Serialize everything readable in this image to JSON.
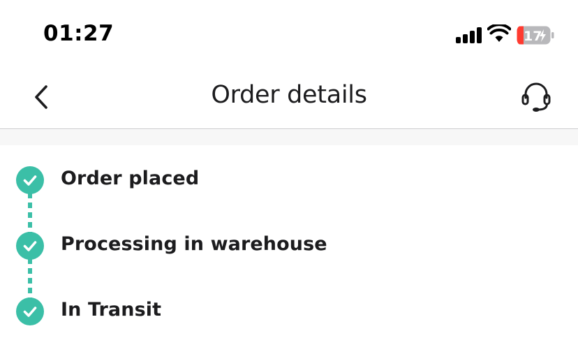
{
  "status_bar": {
    "time": "01:27",
    "battery_level": "17",
    "battery_charging": true,
    "icons": [
      "cellular-signal-icon",
      "wifi-icon",
      "battery-icon"
    ]
  },
  "nav": {
    "title": "Order details",
    "back_icon": "chevron-left-icon",
    "support_icon": "headset-icon"
  },
  "timeline": {
    "steps": [
      {
        "label": "Order placed",
        "completed": true
      },
      {
        "label": "Processing in warehouse",
        "completed": true
      },
      {
        "label": "In Transit",
        "completed": true
      }
    ]
  },
  "colors": {
    "accent": "#3bbfa7",
    "battery_low": "#ff3b30",
    "divider": "#c6c6c8"
  }
}
